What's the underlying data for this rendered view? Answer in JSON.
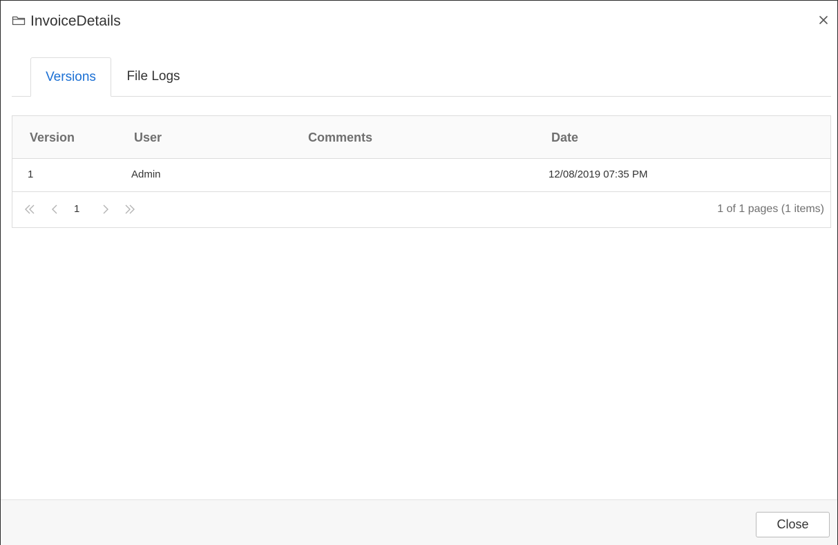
{
  "dialog": {
    "title": "InvoiceDetails",
    "title_icon": "folder-icon",
    "close_icon": "close-icon"
  },
  "tabs": [
    {
      "label": "Versions",
      "active": true
    },
    {
      "label": "File Logs",
      "active": false
    }
  ],
  "grid": {
    "columns": [
      "Version",
      "User",
      "Comments",
      "Date"
    ],
    "rows": [
      {
        "version": "1",
        "user": "Admin",
        "comments": "",
        "date": "12/08/2019 07:35 PM"
      }
    ],
    "pager": {
      "current_page": "1",
      "info": "1 of 1 pages (1 items)",
      "icons": [
        "first-page-icon",
        "prev-page-icon",
        "next-page-icon",
        "last-page-icon"
      ]
    }
  },
  "footer": {
    "close_label": "Close"
  },
  "colors": {
    "accent": "#1a6fd4",
    "border": "#dcdcdc",
    "header_text": "#6f6f6f",
    "footer_bg": "#f7f7f7"
  }
}
